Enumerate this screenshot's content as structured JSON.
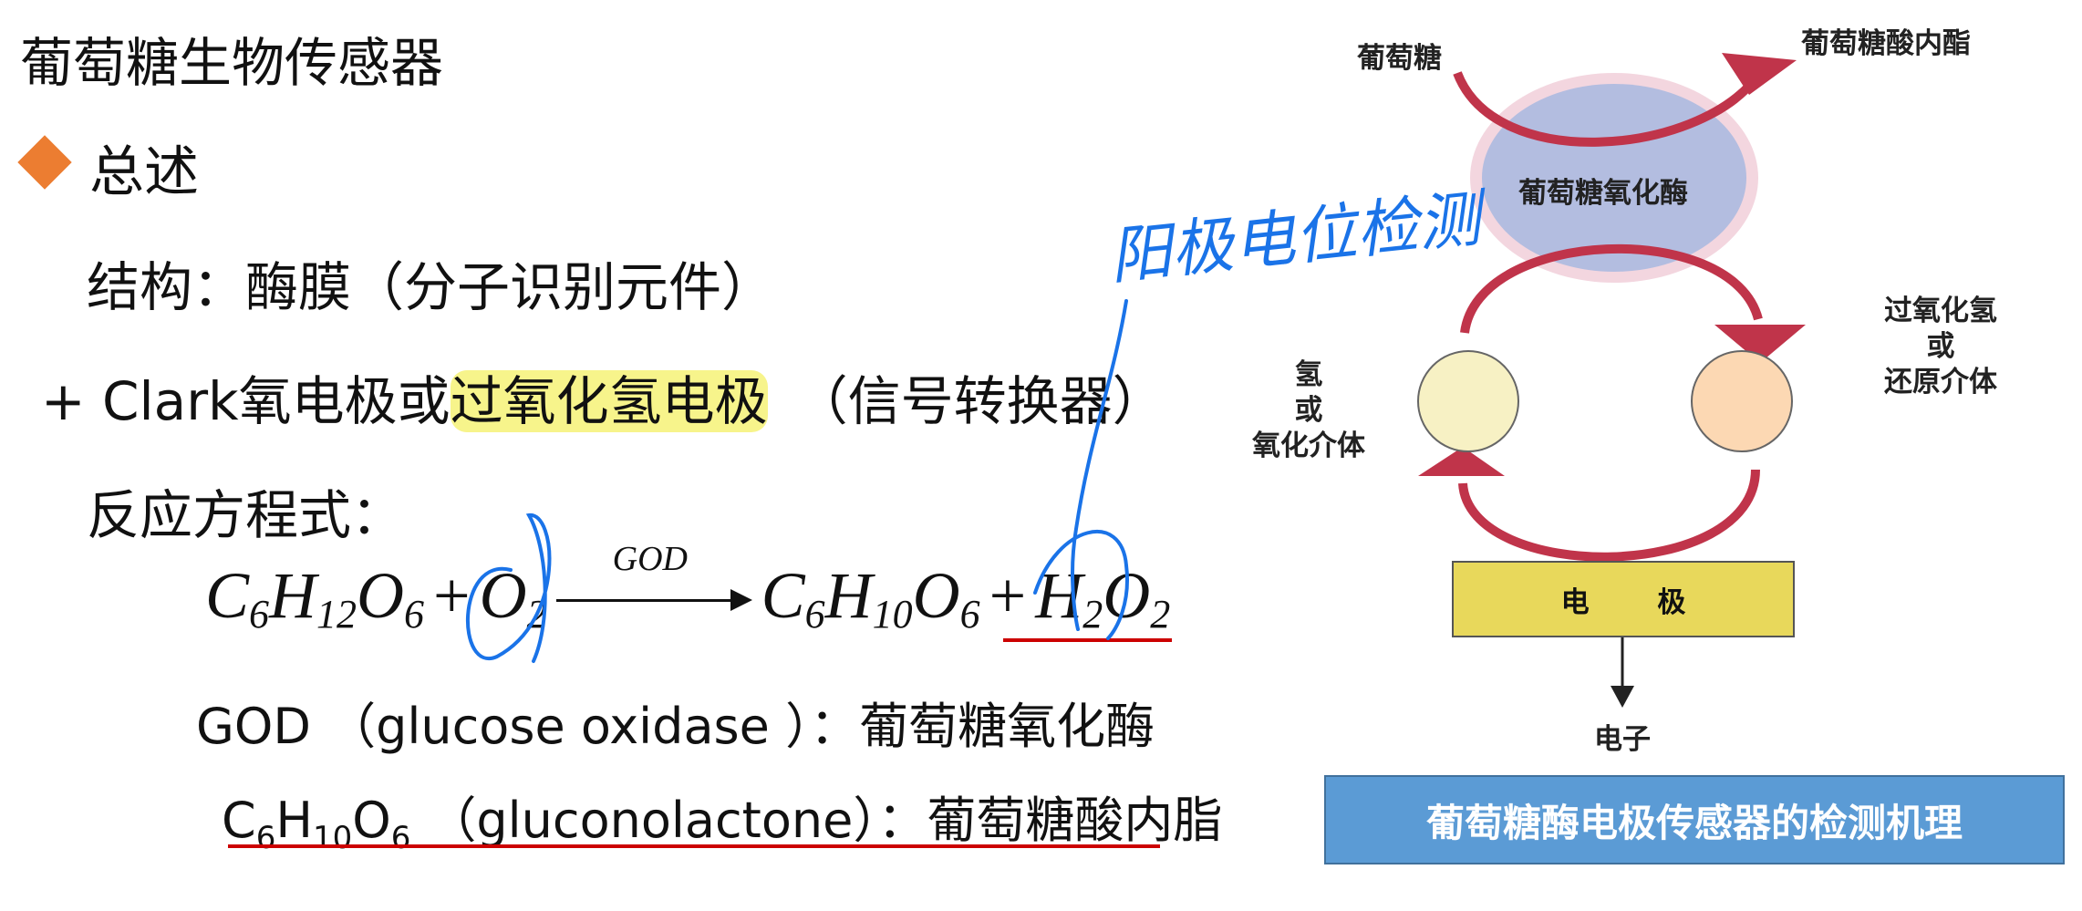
{
  "slide": {
    "title": "葡萄糖生物传感器",
    "section": "总述",
    "structure_line": "结构：酶膜（分子识别元件）",
    "transducer_prefix": "+ Clark氧电极或",
    "transducer_highlight": "过氧化氢电极",
    "transducer_suffix": "（信号转换器）",
    "equation_label": "反应方程式：",
    "equation": {
      "r1": {
        "a": "C",
        "a_sub": "6",
        "b": "H",
        "b_sub": "12",
        "c": "O",
        "c_sub": "6"
      },
      "plus1": "+",
      "r2": {
        "a": "O",
        "a_sub": "2"
      },
      "catalyst": "GOD",
      "p1": {
        "a": "C",
        "a_sub": "6",
        "b": "H",
        "b_sub": "10",
        "c": "O",
        "c_sub": "6"
      },
      "plus2": "+",
      "p2": {
        "a": "H",
        "a_sub": "2",
        "b": "O",
        "b_sub": "2"
      }
    },
    "def_god": "GOD （glucose oxidase ）：葡萄糖氧化酶",
    "def_lactone": {
      "c": "C",
      "c_sub": "6",
      "h": "H",
      "h_sub": "10",
      "o": "O",
      "o_sub": "6",
      "rest": "（gluconolactone）：葡萄糖酸内脂"
    }
  },
  "annotation": {
    "handwritten": "阳极电位检测",
    "ink_color": "#1a73e8",
    "underline_color": "#cc0000",
    "highlight_color": "#f4f05a"
  },
  "diagram": {
    "glucose": "葡萄糖",
    "lactone": "葡萄糖酸内酯",
    "enzyme": "葡萄糖氧化酶",
    "left_species": [
      "氢",
      "或",
      "氧化介体"
    ],
    "right_species": [
      "过氧化氢",
      "或",
      "还原介体"
    ],
    "electrode": "电 极",
    "electron": "电子",
    "caption": "葡萄糖酶电极传感器的检测机理",
    "colors": {
      "arrow": "#c0344a",
      "enzyme_fill": "#b3bde0",
      "enzyme_halo": "#f3d6df",
      "left_circle": "#f7f1c4",
      "right_circle": "#fcd8b3",
      "electrode": "#e8d85b",
      "caption_bg": "#5b9bd5"
    }
  }
}
